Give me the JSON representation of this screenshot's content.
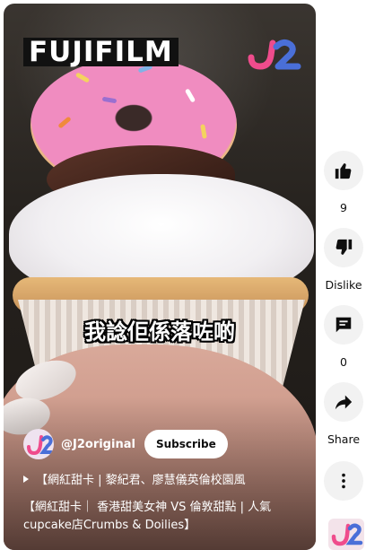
{
  "video": {
    "brand_logo": "FUJIFILM",
    "caption": "我諗佢係落咗啲",
    "channel": {
      "handle": "@J2original",
      "subscribe_label": "Subscribe"
    },
    "playlist_label": "【網紅甜卡 | 黎紀君、廖慧儀英倫校園風",
    "title": "【網紅甜卡｜ 香港甜美女神 VS 倫敦甜點 | 人氣cupcake店Crumbs & Doilies】"
  },
  "actions": {
    "like": {
      "icon": "thumbs-up-icon",
      "count": "9"
    },
    "dislike": {
      "icon": "thumbs-down-icon",
      "label": "Dislike"
    },
    "comment": {
      "icon": "comment-icon",
      "count": "0"
    },
    "share": {
      "icon": "share-icon",
      "label": "Share"
    },
    "more": {
      "icon": "more-vertical-icon"
    }
  },
  "colors": {
    "action_bg": "#f2f2f2",
    "text": "#0f0f0f",
    "subscribe_bg": "#ffffff",
    "j2_pink": "#ef4c8c",
    "j2_blue": "#4a6fd8"
  }
}
